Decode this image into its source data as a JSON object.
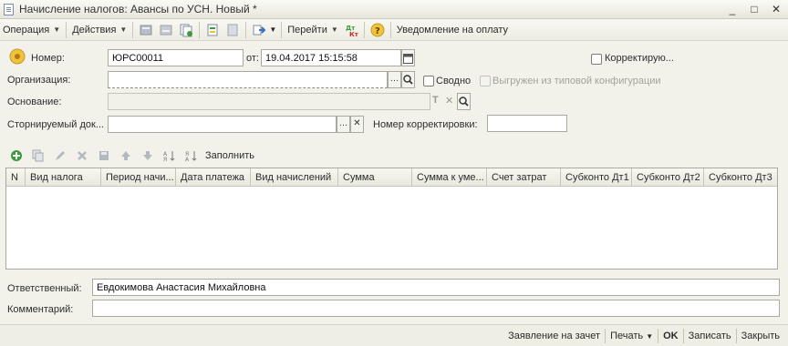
{
  "window": {
    "title": "Начисление налогов: Авансы по УСН. Новый *",
    "controls": {
      "minimize": "_",
      "maximize": "□",
      "close": "✕"
    }
  },
  "toolbar": {
    "operation_label": "Операция",
    "actions_label": "Действия",
    "goto_label": "Перейти",
    "dtkt_icon_text": "Дт Кт",
    "help_icon_text": "?",
    "notice_label": "Уведомление на оплату"
  },
  "form": {
    "number_label": "Номер:",
    "number_value": "ЮРС00011",
    "date_label": "от:",
    "date_value": "19.04.2017 15:15:58",
    "correction_label": "Корректирую...",
    "organization_label": "Организация:",
    "organization_value": "",
    "summary_label": "Сводно",
    "exported_label": "Выгружен из типовой конфигурации",
    "basis_label": "Основание:",
    "basis_value": "",
    "reversal_label": "Сторнируемый док...",
    "reversal_value": "",
    "correction_number_label": "Номер корректировки:",
    "correction_number_value": "",
    "responsible_label": "Ответственный:",
    "responsible_value": "Евдокимова Анастасия Михайловна",
    "comment_label": "Комментарий:",
    "comment_value": ""
  },
  "table_toolbar": {
    "fill_label": "Заполнить"
  },
  "table": {
    "columns": [
      "N",
      "Вид налога",
      "Период начи...",
      "Дата платежа",
      "Вид начислений",
      "Сумма",
      "Сумма к уме...",
      "Счет затрат",
      "Субконто Дт1",
      "Субконто Дт2",
      "Субконто Дт3"
    ],
    "rows": []
  },
  "statusbar": {
    "application_label": "Заявление на зачет",
    "print_label": "Печать",
    "ok_label": "OK",
    "write_label": "Записать",
    "close_label": "Закрыть"
  },
  "colors": {
    "background": "#f2f2ea",
    "accent_yellow": "#f0c43a",
    "icon_blue": "#3d6fb6",
    "icon_green": "#3e9a3e",
    "icon_red": "#cc2a2a"
  }
}
